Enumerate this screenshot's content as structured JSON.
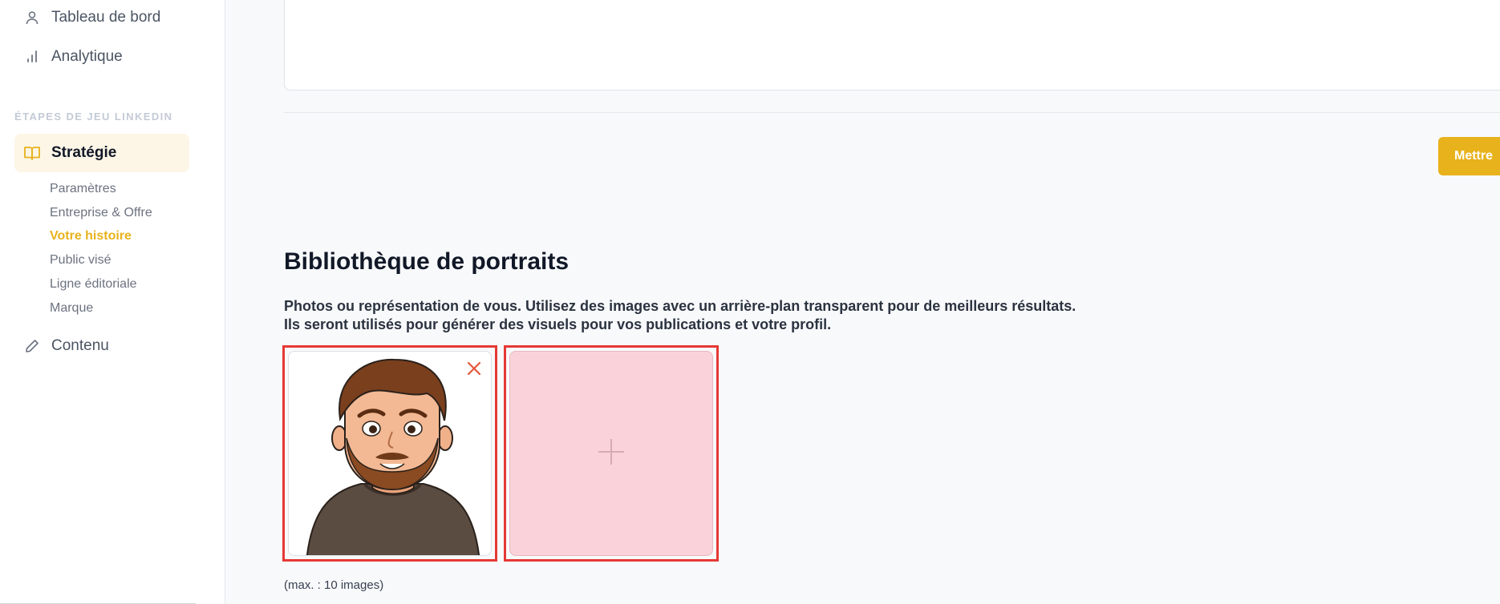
{
  "sidebar": {
    "top_items": [
      {
        "label": "Tableau de bord",
        "icon": "user-icon"
      },
      {
        "label": "Analytique",
        "icon": "bar-chart-icon"
      }
    ],
    "section_heading": "ÉTAPES DE JEU LINKEDIN",
    "active_item": {
      "label": "Stratégie",
      "icon": "book-icon"
    },
    "sub_items": [
      {
        "label": "Paramètres"
      },
      {
        "label": "Entreprise & Offre"
      },
      {
        "label": "Votre histoire",
        "active": true
      },
      {
        "label": "Public visé"
      },
      {
        "label": "Ligne éditoriale"
      },
      {
        "label": "Marque"
      }
    ],
    "bottom_item": {
      "label": "Contenu",
      "icon": "pencil-icon"
    }
  },
  "main": {
    "save_button_label": "Mettre",
    "portrait_section": {
      "title": "Bibliothèque de portraits",
      "description_line1": "Photos ou représentation de vous. Utilisez des images avec un arrière-plan transparent pour de meilleurs résultats.",
      "description_line2": "Ils seront utilisés pour générer des visuels pour vos publications et votre profil.",
      "max_note": "(max. : 10 images)"
    }
  },
  "colors": {
    "accent": "#e8b21c",
    "active_bg": "#fdf6e7",
    "highlight_red": "#e53935",
    "add_tile_bg": "#f9d3d9"
  }
}
